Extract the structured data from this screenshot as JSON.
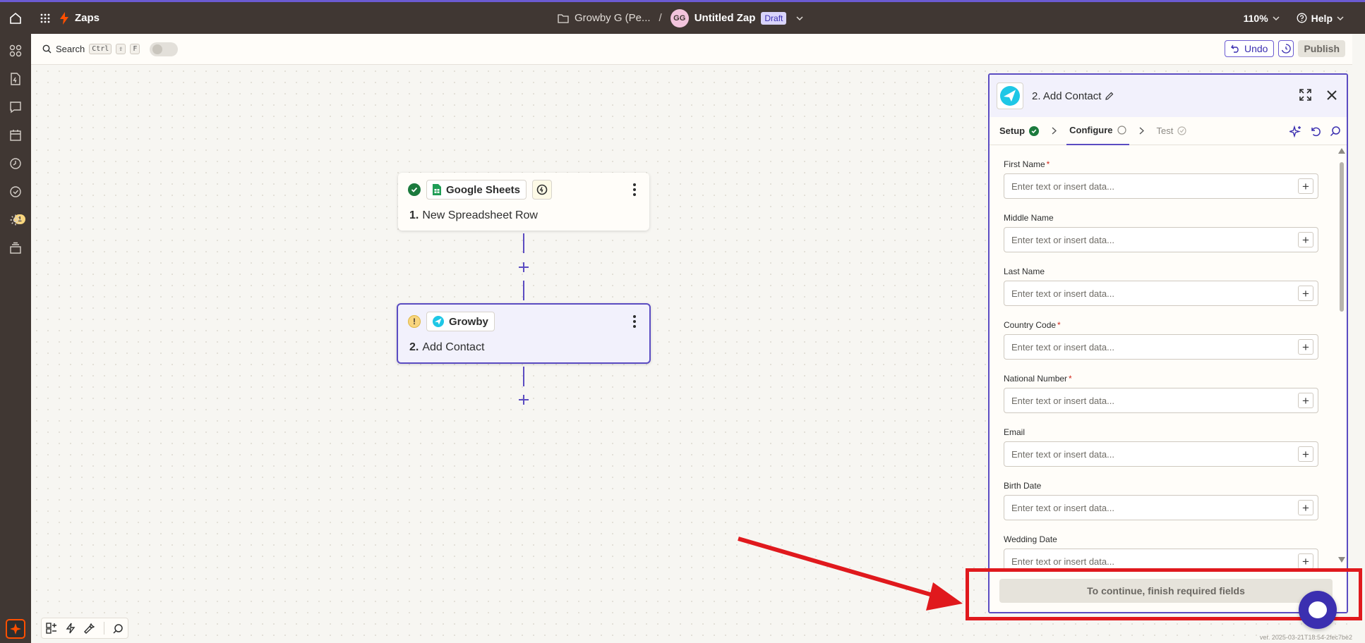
{
  "topbar": {
    "app_name": "Zaps",
    "folder_name": "Growby G (Pe...",
    "separator": "/",
    "avatar_initials": "GG",
    "zap_name": "Untitled Zap",
    "status_badge": "Draft",
    "zoom": "110%",
    "help": "Help"
  },
  "sidebar": {
    "notification_count": "1"
  },
  "toolbar": {
    "search_label": "Search",
    "shortcut_keys": [
      "Ctrl",
      "⇧",
      "F"
    ],
    "undo_label": "Undo",
    "publish_label": "Publish"
  },
  "steps": [
    {
      "number": "1.",
      "app": "Google Sheets",
      "title": "New Spreadsheet Row",
      "status": "complete"
    },
    {
      "number": "2.",
      "app": "Growby",
      "title": "Add Contact",
      "status": "warning"
    }
  ],
  "panel": {
    "title": "2. Add Contact",
    "tabs": {
      "setup": "Setup",
      "configure": "Configure",
      "test": "Test"
    },
    "placeholder": "Enter text or insert data...",
    "fields": [
      {
        "label": "First Name",
        "required": "*"
      },
      {
        "label": "Middle Name",
        "required": ""
      },
      {
        "label": "Last Name",
        "required": ""
      },
      {
        "label": "Country Code",
        "required": "*"
      },
      {
        "label": "National Number",
        "required": "*"
      },
      {
        "label": "Email",
        "required": ""
      },
      {
        "label": "Birth Date",
        "required": ""
      },
      {
        "label": "Wedding Date",
        "required": ""
      }
    ],
    "continue_label": "To continue, finish required fields"
  },
  "version": "ver. 2025-03-21T18:54-2fec7be2",
  "colors": {
    "brand_orange": "#ff4f00",
    "accent_purple": "#5b4cc2",
    "annotation_red": "#e0191d",
    "topbar_bg": "#403733"
  }
}
